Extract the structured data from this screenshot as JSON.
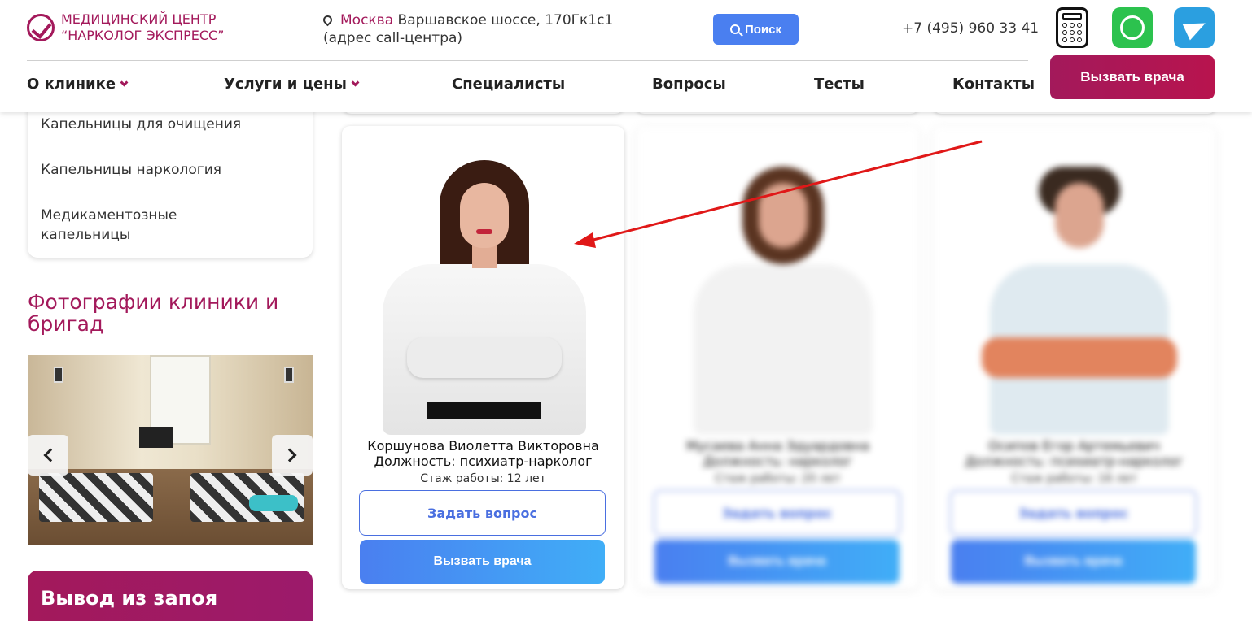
{
  "header": {
    "logo_line1": "МЕДИЦИНСКИЙ ЦЕНТР",
    "logo_line2": "“НАРКОЛОГ ЭКСПРЕСС”",
    "address_city": "Москва",
    "address_street": " Варшавское шоссе, 170Гк1с1",
    "address_note": "(адрес call-центра)",
    "search_label": "Поиск",
    "phone": "+7 (495) 960 33 41",
    "call_doctor_label": "Вызвать врача",
    "nav": [
      {
        "label": "О клинике",
        "has_dropdown": true
      },
      {
        "label": "Услуги и цены",
        "has_dropdown": true
      },
      {
        "label": "Специалисты",
        "has_dropdown": false
      },
      {
        "label": "Вопросы",
        "has_dropdown": false
      },
      {
        "label": "Тесты",
        "has_dropdown": false
      },
      {
        "label": "Контакты",
        "has_dropdown": false
      }
    ],
    "icons": [
      "calculator-icon",
      "whatsapp-icon",
      "telegram-icon"
    ]
  },
  "sidebar": {
    "submenu": [
      {
        "label": "Капельницы для очищения"
      },
      {
        "label": "Капельницы наркология"
      },
      {
        "label": "Медикаментозные капельницы"
      }
    ],
    "photos_title": "Фотографии клиники и бригад",
    "promo_title": "Вывод из запоя"
  },
  "doctors": [
    {
      "name": "Коршунова Виолетта Викторовна",
      "position": "Должность: психиатр-нарколог",
      "experience": "Стаж работы: 12 лет",
      "ask_label": "Задать вопрос",
      "call_label": "Вызвать врача",
      "blurred": false
    },
    {
      "name": "Мусаева Анна Эдуардовна",
      "position": "Должность: нарколог",
      "experience": "Стаж работы: 20 лет",
      "ask_label": "Задать вопрос",
      "call_label": "Вызвать врача",
      "blurred": true
    },
    {
      "name": "Осипов Егор Артемьевич",
      "position": "Должность: психиатр-нарколог",
      "experience": "Стаж работы: 16 лет",
      "ask_label": "Задать вопрос",
      "call_label": "Вызвать врача",
      "blurred": true
    }
  ],
  "colors": {
    "brand": "#a3195b",
    "accent_blue": "#4a7ff0",
    "annotation": "#e01818"
  }
}
